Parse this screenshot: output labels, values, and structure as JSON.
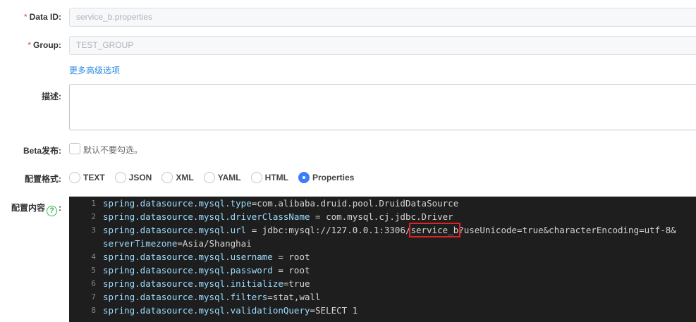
{
  "form": {
    "required_mark": "*",
    "data_id": {
      "label": "Data ID:",
      "value": "service_b.properties"
    },
    "group": {
      "label": "Group:",
      "value": "TEST_GROUP"
    },
    "advanced_link": "更多高级选项",
    "description": {
      "label": "描述:",
      "value": ""
    },
    "beta": {
      "label": "Beta发布:",
      "checkbox_text": "默认不要勾选。",
      "checked": false
    },
    "format": {
      "label": "配置格式:",
      "options": [
        "TEXT",
        "JSON",
        "XML",
        "YAML",
        "HTML",
        "Properties"
      ],
      "selected": "Properties"
    },
    "content": {
      "label_text": "配置内容",
      "help_glyph": "?",
      "colon": ":"
    }
  },
  "editor": {
    "lines": [
      {
        "num": "1",
        "key": "spring.datasource.mysql.type",
        "val": "=com.alibaba.druid.pool.DruidDataSource"
      },
      {
        "num": "2",
        "key": "spring.datasource.mysql.driverClassName",
        "val": " = com.mysql.cj.jdbc.Driver"
      },
      {
        "num": "3",
        "key": "spring.datasource.mysql.url",
        "val_a": " = jdbc:mysql://127.0.0.1:3306/",
        "val_hl": "service_b",
        "val_b": "?useUnicode=true&characterEncoding=utf-8&"
      },
      {
        "num": "",
        "key": "serverTimezone",
        "val": "=Asia/Shanghai"
      },
      {
        "num": "4",
        "key": "spring.datasource.mysql.username",
        "val": " = root"
      },
      {
        "num": "5",
        "key": "spring.datasource.mysql.password",
        "val": " = root"
      },
      {
        "num": "6",
        "key": "spring.datasource.mysql.initialize",
        "val": "=true"
      },
      {
        "num": "7",
        "key": "spring.datasource.mysql.filters",
        "val": "=stat,wall"
      },
      {
        "num": "8",
        "key": "spring.datasource.mysql.validationQuery",
        "val": "=SELECT 1"
      }
    ]
  },
  "colors": {
    "accent": "#3e7bf7",
    "link": "#2f8be8",
    "required": "#e0453d",
    "editor_bg": "#1e1e1e",
    "code_key": "#9cdcfe",
    "code_value": "#d4d4d4",
    "highlight_box": "#e02222",
    "help_icon": "#2eb551"
  }
}
